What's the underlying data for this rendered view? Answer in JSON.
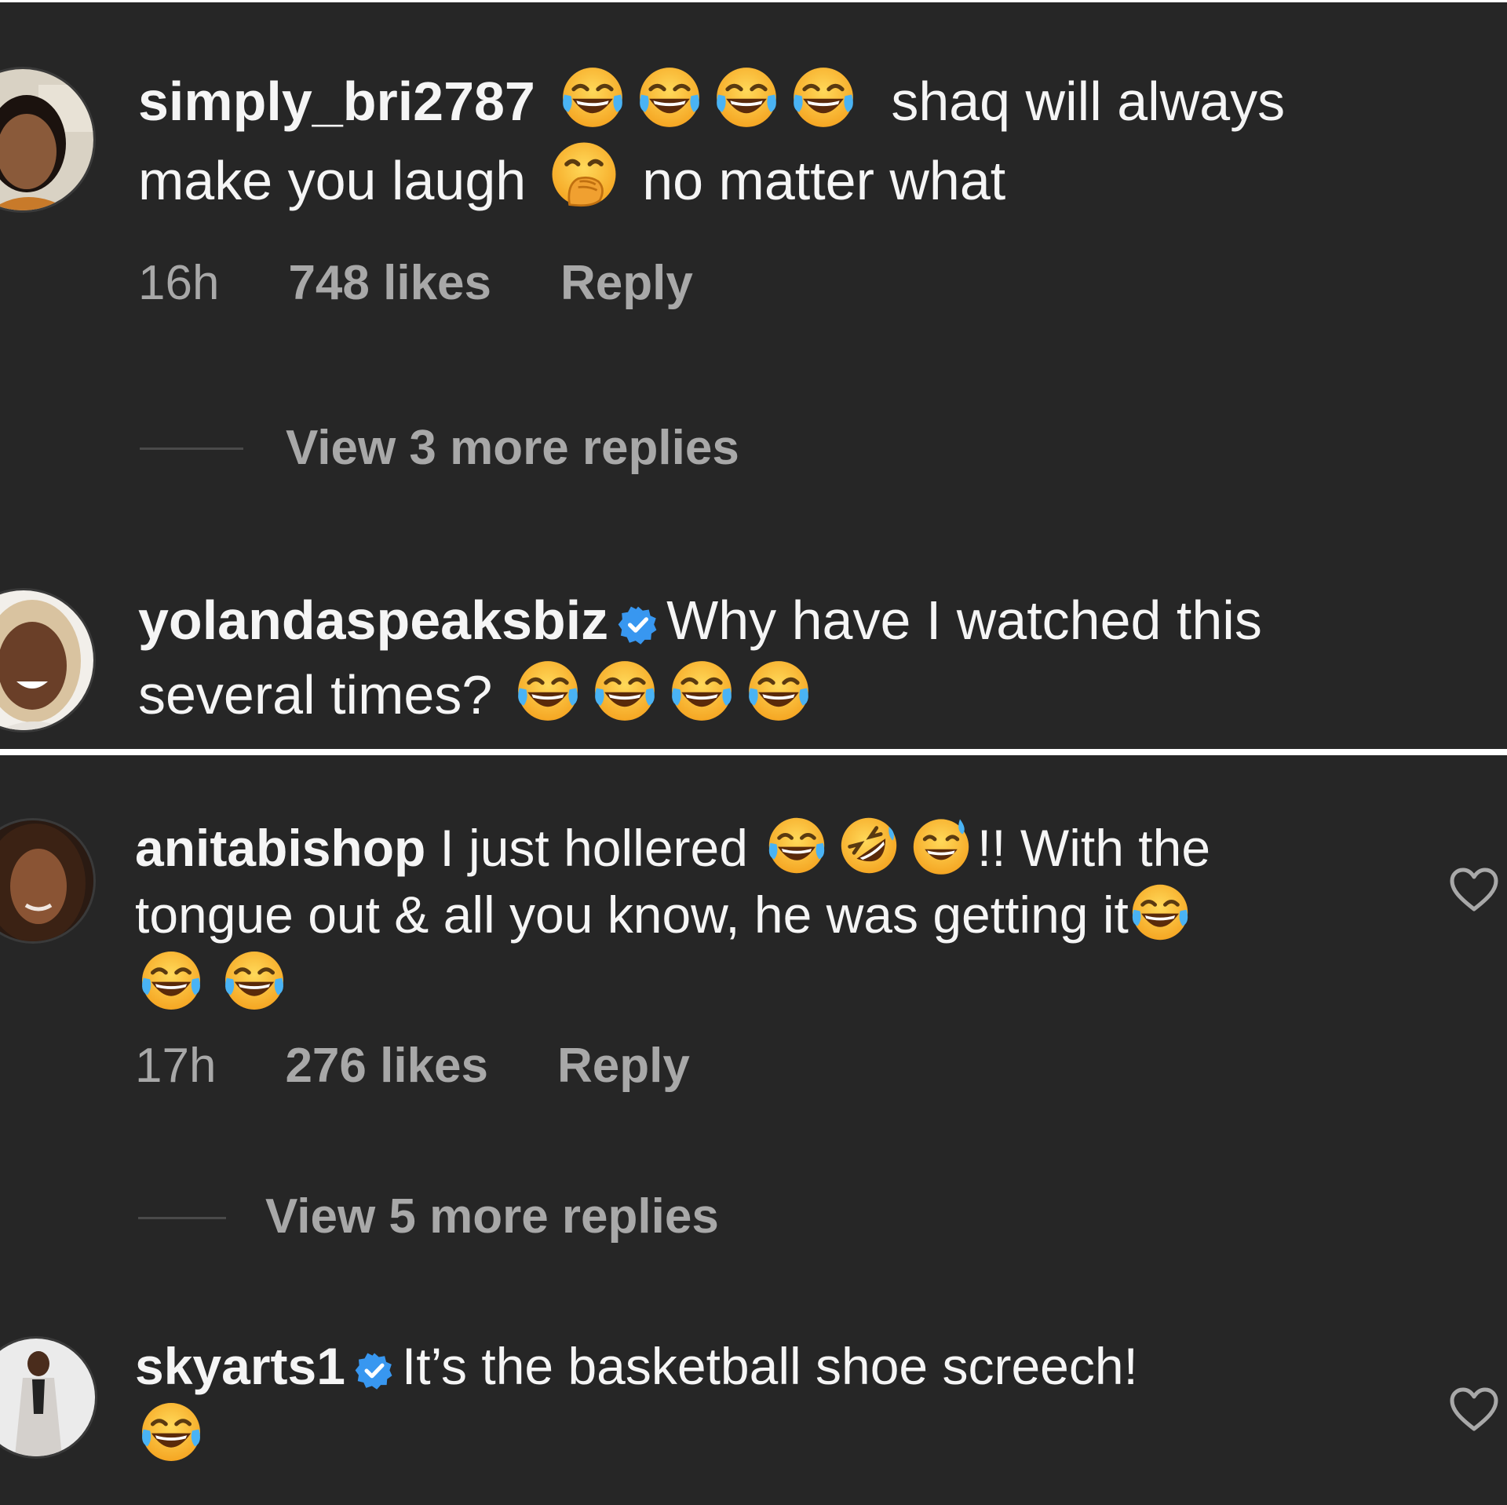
{
  "comments": [
    {
      "username": "simply_bri2787",
      "line1_after": "shaq will always",
      "line2_before": "make you laugh",
      "line2_after": "no matter what",
      "time": "16h",
      "likes": "748 likes",
      "reply": "Reply",
      "view_replies": "View 3 more replies",
      "emojis": [
        "face-with-tears-of-joy",
        "face-with-tears-of-joy",
        "face-with-tears-of-joy",
        "face-with-tears-of-joy",
        "face-with-hand-over-mouth"
      ]
    },
    {
      "username": "yolandaspeaksbiz",
      "verified": true,
      "line1_after": "Why have I watched this",
      "line2_before": "several times?",
      "emojis": [
        "face-with-tears-of-joy",
        "face-with-tears-of-joy",
        "face-with-tears-of-joy",
        "face-with-tears-of-joy"
      ]
    },
    {
      "username": "anitabishop",
      "line1_after": "I just hollered",
      "line1_tail": "!! With the",
      "line2_before": "tongue out & all you know, he was getting it",
      "time": "17h",
      "likes": "276 likes",
      "reply": "Reply",
      "view_replies": "View 5 more replies",
      "emojis": [
        "face-with-tears-of-joy",
        "rolling-on-the-floor-laughing",
        "grinning-face-with-sweat",
        "face-with-tears-of-joy",
        "face-with-tears-of-joy",
        "face-with-tears-of-joy"
      ]
    },
    {
      "username": "skyarts1",
      "verified": true,
      "line1_after": "It’s the basketball shoe screech!",
      "emojis": [
        "face-with-tears-of-joy"
      ]
    }
  ],
  "icons": {
    "like": "heart-outline-icon",
    "verified": "verified-badge-icon"
  },
  "colors": {
    "background": "#262626",
    "text": "#f5f5f5",
    "secondary": "#a8a8a8",
    "verified": "#3897f0",
    "divider": "#ffffff"
  }
}
